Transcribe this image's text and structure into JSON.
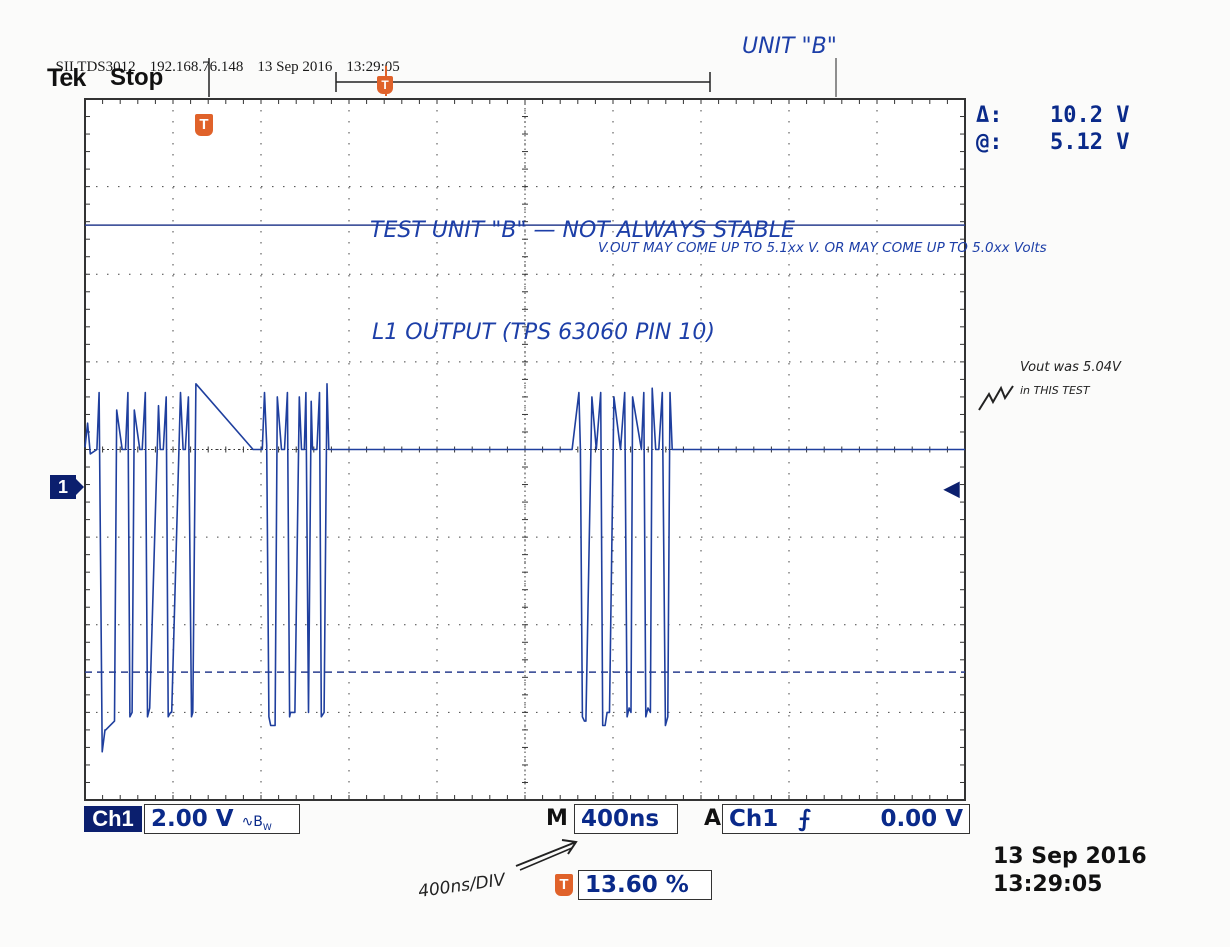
{
  "header": {
    "model": "SII TDS3012",
    "ip": "192.168.76.148",
    "date": "13 Sep 2016",
    "time": "13:29:05",
    "brand": "Tek",
    "run_state": "Stop"
  },
  "handwritten": {
    "unit": "UNIT \"B\"",
    "title_line1": "TEST UNIT \"B\" — NOT ALWAYS STABLE",
    "title_line2": "V.OUT MAY COME UP TO 5.1xx V. OR MAY COME UP TO 5.0xx Volts",
    "signal": "L1 OUTPUT (TPS 63060 PIN 10)",
    "note_line1": "Vout was 5.04V",
    "note_line2": "in THIS TEST",
    "timebase_note": "400ns/DIV"
  },
  "measurements": {
    "delta_label": "Δ:",
    "delta_value": "10.2 V",
    "at_label": "@:",
    "at_value": "5.12 V"
  },
  "status_bar": {
    "channel": "Ch1",
    "volts_div": "2.00 V",
    "bw_icon": "∿B",
    "bw_sub": "W",
    "m_label": "M",
    "timebase": "400ns",
    "a_label": "A",
    "trig_source": "Ch1",
    "trig_slope": "⨍",
    "trig_level": "0.00 V",
    "trig_pos": "13.60 %",
    "date": "13 Sep 2016",
    "time": "13:29:05"
  },
  "markers": {
    "trigger_letter": "T",
    "channel_marker": "1"
  },
  "colors": {
    "trace": "#1f3f9e",
    "trigger": "#e0622a",
    "grid": "#444444",
    "cursor": "#2a3f8f"
  },
  "chart_data": {
    "type": "line",
    "title": "",
    "xlabel": "",
    "ylabel": "",
    "x_unit": "ns",
    "y_unit": "V",
    "xlim": [
      -544,
      3456
    ],
    "ylim": [
      -8,
      8
    ],
    "grid": true,
    "cursors_v": [
      5.12,
      -5.08
    ],
    "series": [
      {
        "name": "Ch1",
        "x": [
          -544,
          -532,
          -520,
          -490,
          -480,
          -466,
          -453,
          -450,
          -410,
          -400,
          -375,
          -360,
          -349,
          -340,
          -330,
          -320,
          -295,
          -284,
          -270,
          -260,
          -250,
          -210,
          -202,
          -188,
          -175,
          -166,
          -155,
          -150,
          -110,
          -98,
          -88,
          -74,
          -60,
          -54,
          -40,
          220,
          262,
          272,
          282,
          292,
          300,
          320,
          330,
          349,
          363,
          376,
          386,
          390,
          410,
          430,
          440,
          453,
          460,
          472,
          484,
          490,
          510,
          522,
          530,
          543,
          556,
          564,
          576,
          590,
          1670,
          1701,
          1708,
          1717,
          1726,
          1733,
          1760,
          1780,
          1800,
          1809,
          1820,
          1829,
          1840,
          1860,
          1890,
          1909,
          1920,
          1929,
          1938,
          1945,
          1985,
          1996,
          2005,
          2015,
          2026,
          2034,
          2050,
          2064,
          2080,
          2094,
          2105,
          2115,
          2125,
          2140,
          3456
        ],
        "y": [
          0.05,
          0.6,
          -0.1,
          0.0,
          1.3,
          -6.9,
          -6.4,
          -6.4,
          -6.2,
          0.9,
          0.0,
          0.0,
          1.3,
          -6.1,
          -6.0,
          0.9,
          0.0,
          0.0,
          1.3,
          -6.1,
          -5.9,
          1.0,
          0.0,
          0.0,
          1.2,
          -6.1,
          -6.0,
          -6.0,
          1.3,
          0.0,
          0.0,
          1.2,
          -6.1,
          -6.0,
          1.5,
          0.0,
          0.0,
          1.3,
          0.1,
          -6.1,
          -6.3,
          -6.3,
          1.2,
          0.0,
          0.0,
          1.3,
          -6.1,
          -6.0,
          -6.0,
          1.2,
          0.0,
          0.0,
          1.3,
          -6.0,
          1.1,
          0.0,
          0.0,
          1.3,
          -6.1,
          -6.0,
          1.5,
          0.0,
          0.0,
          0.0,
          0.0,
          1.3,
          0.0,
          -6.1,
          -6.2,
          -6.2,
          1.2,
          0.0,
          1.3,
          -6.3,
          -6.3,
          -6.0,
          -6.0,
          1.2,
          0.0,
          1.3,
          -6.1,
          -5.9,
          -6.0,
          1.2,
          0.0,
          1.3,
          -6.1,
          -5.9,
          -6.0,
          1.4,
          0.0,
          0.0,
          1.3,
          -6.3,
          -6.1,
          1.3,
          0.0,
          0.0,
          0.0
        ]
      }
    ]
  }
}
